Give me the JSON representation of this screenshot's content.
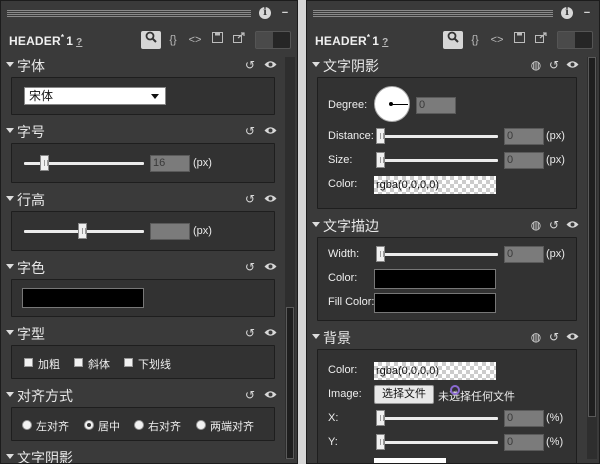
{
  "left_panel": {
    "header": {
      "name": "HEADER",
      "mark": "*",
      "count": "1",
      "help": "?"
    },
    "sections": {
      "font": {
        "title": "字体",
        "select_value": "宋体"
      },
      "size": {
        "title": "字号",
        "value": "16",
        "unit": "(px)"
      },
      "line_height": {
        "title": "行高",
        "value": "",
        "unit": "(px)"
      },
      "color": {
        "title": "字色",
        "swatch": "#000000"
      },
      "style": {
        "title": "字型",
        "options": [
          "加粗",
          "斜体",
          "下划线"
        ]
      },
      "align": {
        "title": "对齐方式",
        "options": [
          "左对齐",
          "居中",
          "右对齐",
          "两端对齐"
        ],
        "selected": "居中"
      },
      "next": {
        "title": "文字阴影"
      }
    }
  },
  "right_panel": {
    "header": {
      "name": "HEADER",
      "mark": "*",
      "count": "1",
      "help": "?"
    },
    "sections": {
      "shadow": {
        "title": "文字阴影",
        "degree_label": "Degree:",
        "degree_value": "0",
        "distance_label": "Distance:",
        "distance_value": "0",
        "distance_unit": "(px)",
        "size_label": "Size:",
        "size_value": "0",
        "size_unit": "(px)",
        "color_label": "Color:",
        "color_value": "rgba(0,0,0,0)"
      },
      "stroke": {
        "title": "文字描边",
        "width_label": "Width:",
        "width_value": "0",
        "width_unit": "(px)",
        "color_label": "Color:",
        "fill_color_label": "Fill Color:"
      },
      "background": {
        "title": "背景",
        "color_label": "Color:",
        "color_value": "rgba(0,0,0,0)",
        "image_label": "Image:",
        "file_button": "选择文件",
        "file_status": "未选择任何文件",
        "x_label": "X:",
        "x_value": "0",
        "x_unit": "(%)",
        "y_label": "Y:",
        "y_value": "0",
        "y_unit": "(%)"
      }
    }
  },
  "colors": {
    "panel": "#3a3a3a",
    "section_body": "#323232",
    "border": "#1e1e1e"
  }
}
